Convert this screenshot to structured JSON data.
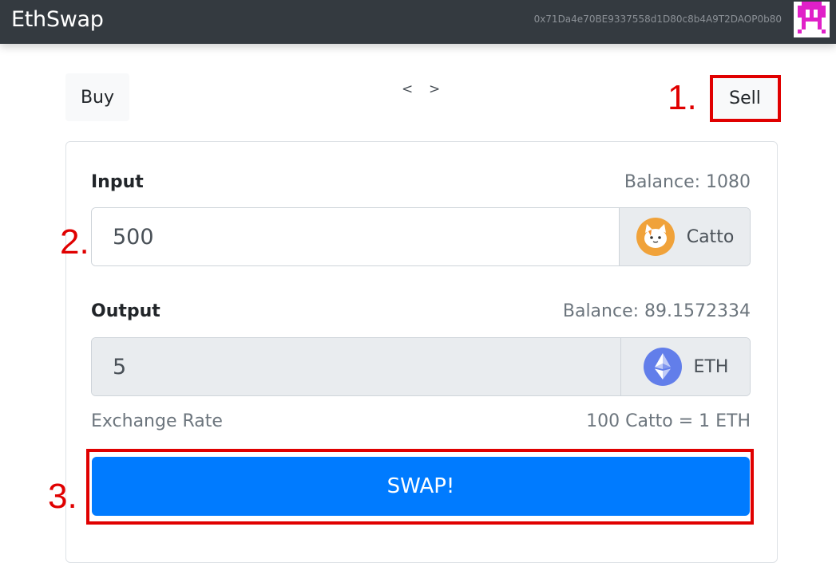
{
  "navbar": {
    "brand": "EthSwap",
    "account_address": "0x71Da4e70BE9337558d1D80c8b4A9T2DAOP0b80",
    "avatar_icon": "identicon-avatar"
  },
  "tabs": {
    "buy_label": "Buy",
    "sell_label": "Sell",
    "prev_label": "<",
    "next_label": ">"
  },
  "form": {
    "input": {
      "label": "Input",
      "balance_text": "Balance: 1080",
      "value": "500",
      "token_name": "Catto",
      "token_icon": "cat-token-icon"
    },
    "output": {
      "label": "Output",
      "balance_text": "Balance: 89.1572334",
      "value": "5",
      "token_name": "ETH",
      "token_icon": "ethereum-icon"
    },
    "exchange_rate_label": "Exchange Rate",
    "exchange_rate_value": "100 Catto = 1 ETH",
    "swap_label": "SWAP!"
  },
  "annotations": {
    "step1": "1.",
    "step2": "2.",
    "step3": "3."
  },
  "colors": {
    "navbar_bg": "#343a40",
    "primary": "#007bff",
    "highlight": "#e00000"
  }
}
